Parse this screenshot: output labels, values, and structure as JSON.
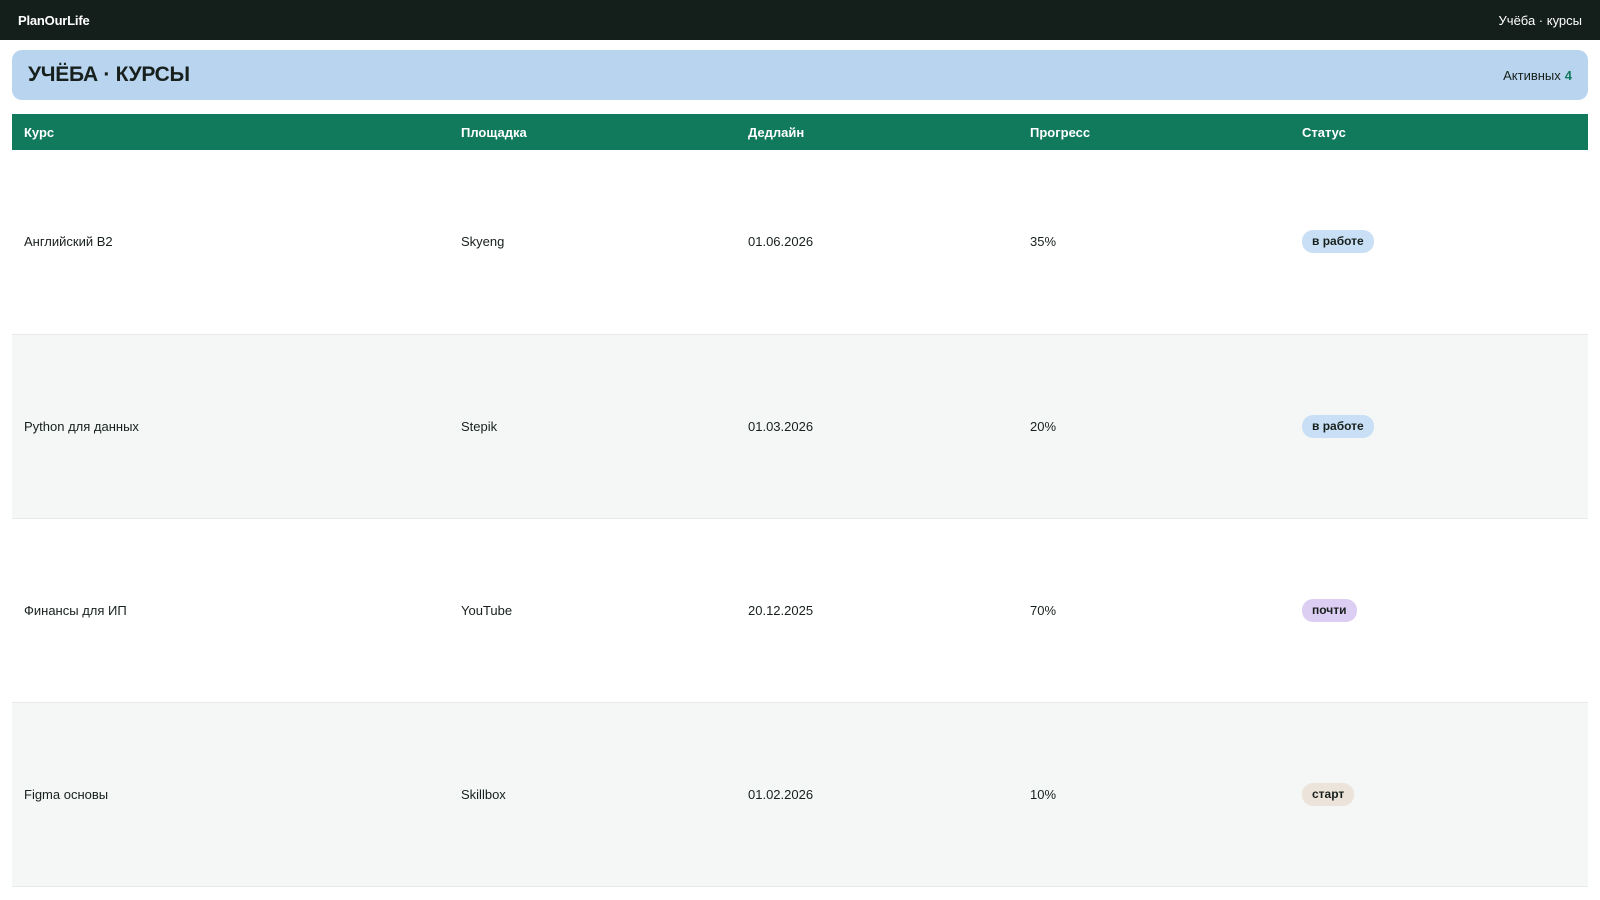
{
  "app": {
    "brand": "PlanOurLife",
    "breadcrumb": "Учёба · курсы"
  },
  "banner": {
    "title": "УЧЁБА · КУРСЫ",
    "stat_label": "Активных",
    "stat_value": "4"
  },
  "table": {
    "headers": {
      "course": "Курс",
      "platform": "Площадка",
      "deadline": "Дедлайн",
      "progress": "Прогресс",
      "status": "Статус"
    },
    "rows": [
      {
        "course": "Английский B2",
        "platform": "Skyeng",
        "deadline": "01.06.2026",
        "progress": "35%",
        "status": "в работе",
        "status_color": "#c9dff5"
      },
      {
        "course": "Python для данных",
        "platform": "Stepik",
        "deadline": "01.03.2026",
        "progress": "20%",
        "status": "в работе",
        "status_color": "#c9dff5"
      },
      {
        "course": "Финансы для ИП",
        "platform": "YouTube",
        "deadline": "20.12.2025",
        "progress": "70%",
        "status": "почти",
        "status_color": "#dccdf3"
      },
      {
        "course": "Figma основы",
        "platform": "Skillbox",
        "deadline": "01.02.2026",
        "progress": "10%",
        "status": "старт",
        "status_color": "#ece4da"
      }
    ]
  },
  "colors": {
    "topbar": "#141f1b",
    "banner": "#b9d4ef",
    "table_header": "#117a5d",
    "accent": "#137b5e"
  }
}
